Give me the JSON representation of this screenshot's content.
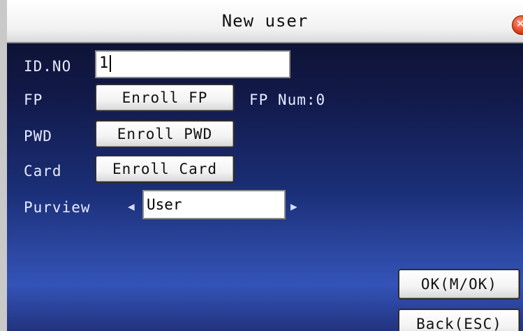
{
  "window": {
    "title": "New user"
  },
  "form": {
    "id_label": "ID.NO",
    "id_value": "1",
    "fp_label": "FP",
    "fp_button": "Enroll FP",
    "fp_num_label": "FP Num:0",
    "pwd_label": "PWD",
    "pwd_button": "Enroll PWD",
    "card_label": "Card",
    "card_button": "Enroll Card",
    "purview_label": "Purview",
    "purview_value": "User"
  },
  "actions": {
    "ok_label": "OK(M/OK)",
    "back_label": "Back(ESC)"
  },
  "icons": {
    "close": "close-icon",
    "left": "left-arrow-icon",
    "right": "right-arrow-icon"
  }
}
